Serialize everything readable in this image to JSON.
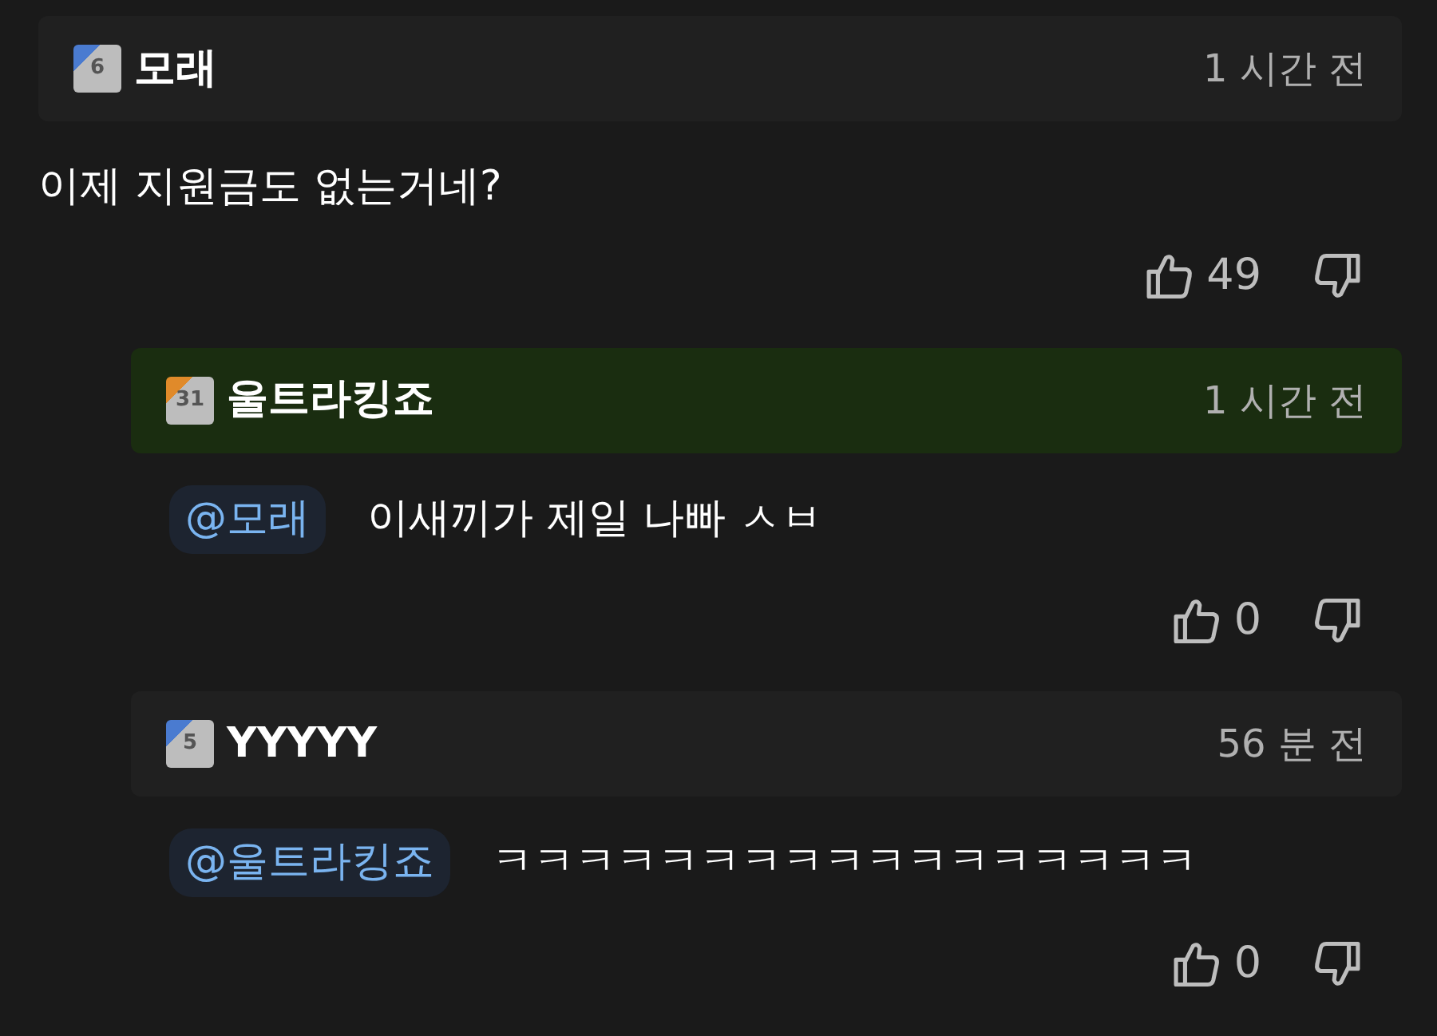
{
  "comment": {
    "author": "모래",
    "badge": {
      "text": "6",
      "color": "#4a7bd0"
    },
    "time": "1 시간 전",
    "highlighted": false,
    "text": "이제 지원금도 없는거네?",
    "likes": "49"
  },
  "replies": [
    {
      "author": "울트라킹죠",
      "badge": {
        "text": "31",
        "color": "#e08a2a"
      },
      "time": "1 시간 전",
      "highlighted": true,
      "mention": "@모래",
      "text": "이새끼가 제일 나빠 ㅅㅂ",
      "likes": "0"
    },
    {
      "author": "YYYYY",
      "badge": {
        "text": "5",
        "color": "#4a7bd0"
      },
      "time": "56 분 전",
      "highlighted": false,
      "mention": "@울트라킹죠",
      "text": "ㅋㅋㅋㅋㅋㅋㅋㅋㅋㅋㅋㅋㅋㅋㅋㅋㅋ",
      "likes": "0"
    }
  ]
}
